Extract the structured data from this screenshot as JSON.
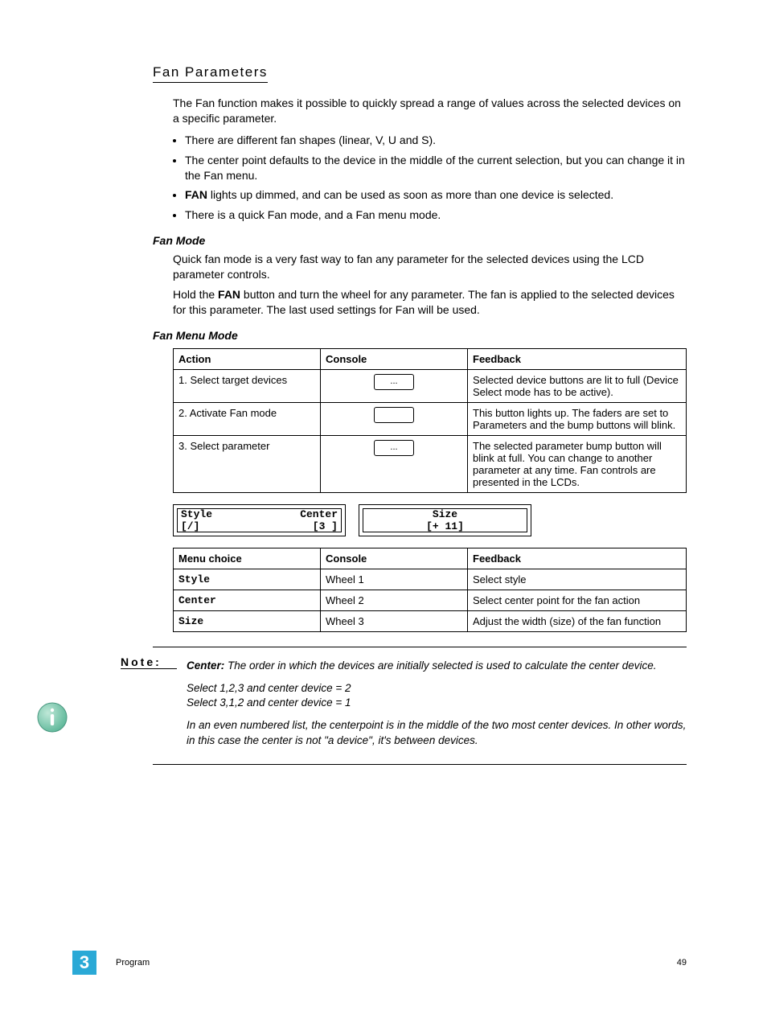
{
  "section_title": "Fan Parameters",
  "intro": "The Fan function makes it possible to quickly spread a range of values across the selected devices on a specific parameter.",
  "bullets": [
    "There are different fan shapes (linear, V, U and S).",
    "The center point defaults to the device in the middle of the current selection, but you can change it in the Fan menu.",
    "",
    "There is a quick Fan mode, and a Fan menu mode."
  ],
  "bullet3_prefix_bold": "FAN",
  "bullet3_rest": " lights up dimmed, and can be used as soon as more than one device is selected.",
  "fan_mode_heading": "Fan Mode",
  "fan_mode_p1": "Quick fan mode is a very fast way to fan any parameter for the selected devices using the LCD parameter controls.",
  "fan_mode_p2_a": "Hold the ",
  "fan_mode_p2_bold": "FAN",
  "fan_mode_p2_b": " button and turn the wheel for any parameter. The fan is applied to the selected devices for this parameter. The last used settings for Fan will be used.",
  "fan_menu_mode_heading": "Fan Menu Mode",
  "table1": {
    "headers": [
      "Action",
      "Console",
      "Feedback"
    ],
    "rows": [
      {
        "action": "1. Select target devices",
        "console_btn": "...",
        "feedback": "Selected device buttons are lit to full (Device Select mode has to be active)."
      },
      {
        "action": "2. Activate Fan mode",
        "console_btn": "",
        "feedback": "This button lights up. The faders are set to Parameters and the bump buttons will blink."
      },
      {
        "action": "3. Select parameter",
        "console_btn": "...",
        "feedback": "The selected parameter bump button will blink at full. You can change to another parameter at any time. Fan controls are presented in the LCDs."
      }
    ]
  },
  "lcd": {
    "box1": {
      "l1a": "Style",
      "l1b": "Center",
      "l2a": "[/]",
      "l2b": "[3 ]"
    },
    "box2": {
      "title": "Size",
      "value": "[+ 11]"
    }
  },
  "table2": {
    "headers": [
      "Menu choice",
      "Console",
      "Feedback"
    ],
    "rows": [
      {
        "menu": "Style",
        "console": "Wheel 1",
        "feedback": "Select style"
      },
      {
        "menu": "Center",
        "console": "Wheel 2",
        "feedback": "Select center point for the fan action"
      },
      {
        "menu": "Size",
        "console": "Wheel 3",
        "feedback": "Adjust the width (size) of the fan function"
      }
    ]
  },
  "note": {
    "label": "Note:",
    "p1_bold": "Center:",
    "p1_rest": " The order in which the devices are initially selected is used to calculate the center device.",
    "p2": "Select 1,2,3 and center device = 2\nSelect 3,1,2 and center device = 1",
    "p3": "In an even numbered list, the centerpoint is in the middle of the two most center devices. In other words, in this case the center is not \"a device\", it's between devices."
  },
  "footer": {
    "chapter_number": "3",
    "chapter_name": "Program",
    "page_number": "49"
  }
}
